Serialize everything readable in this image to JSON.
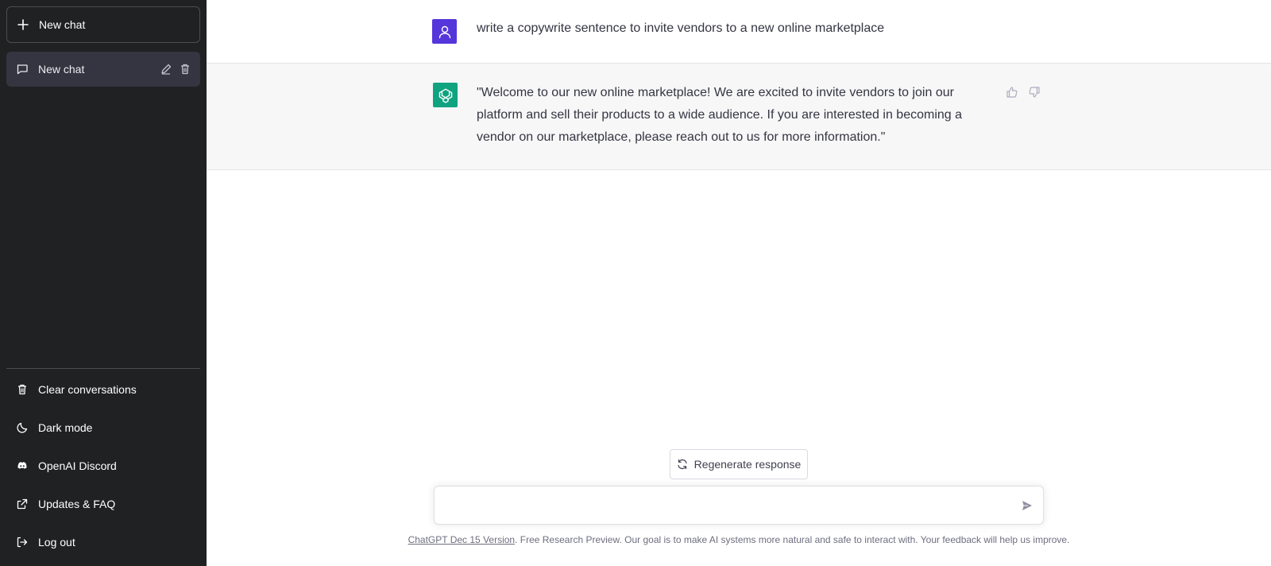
{
  "sidebar": {
    "new_chat_label": "New chat",
    "chats": [
      {
        "label": "New chat"
      }
    ],
    "menu": [
      {
        "label": "Clear conversations",
        "icon": "trash-icon"
      },
      {
        "label": "Dark mode",
        "icon": "moon-icon"
      },
      {
        "label": "OpenAI Discord",
        "icon": "discord-icon"
      },
      {
        "label": "Updates & FAQ",
        "icon": "external-link-icon"
      },
      {
        "label": "Log out",
        "icon": "logout-icon"
      }
    ]
  },
  "conversation": {
    "user_message": "write a copywrite sentence to invite vendors to a new online marketplace",
    "assistant_message": "\"Welcome to our new online marketplace! We are excited to invite vendors to join our platform and sell their products to a wide audience. If you are interested in becoming a vendor on our marketplace, please reach out to us for more information.\""
  },
  "composer": {
    "regenerate_label": "Regenerate response",
    "input_value": "",
    "input_placeholder": ""
  },
  "footer": {
    "version_link": "ChatGPT Dec 15 Version",
    "text": ". Free Research Preview. Our goal is to make AI systems more natural and safe to interact with. Your feedback will help us improve."
  },
  "colors": {
    "sidebar_bg": "#202123",
    "user_avatar": "#5436da",
    "assistant_avatar": "#10a37f",
    "assistant_row_bg": "#f7f7f8"
  }
}
